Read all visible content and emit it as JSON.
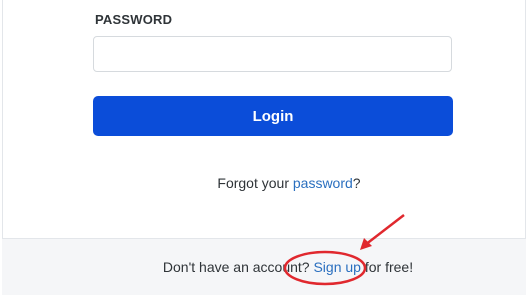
{
  "password": {
    "label": "PASSWORD",
    "value": "",
    "placeholder": ""
  },
  "login": {
    "label": "Login"
  },
  "forgot": {
    "prefix": "Forgot your ",
    "link": "password",
    "suffix": "?"
  },
  "signup": {
    "prefix": "Don't have an account? ",
    "link": "Sign up",
    "suffix": " for free!"
  },
  "colors": {
    "button": "#0b4dd9",
    "link": "#2a6fbf",
    "annotation": "#e0282e"
  }
}
